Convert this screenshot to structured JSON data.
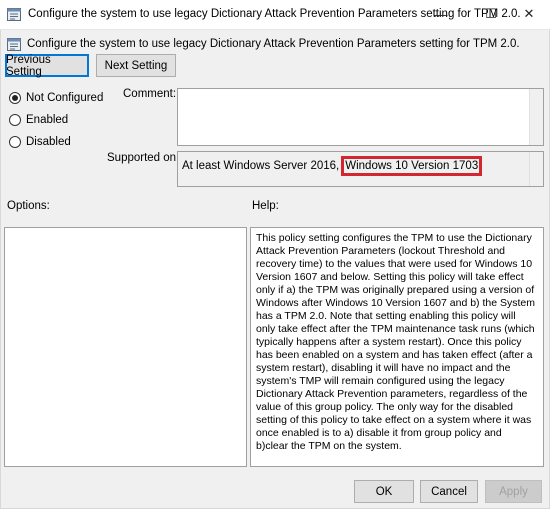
{
  "window": {
    "title": "Configure the system to use legacy Dictionary Attack Prevention Parameters setting for TPM 2.0.",
    "minimize_glyph": "—",
    "maximize_glyph": "☐",
    "close_glyph": "✕"
  },
  "header": {
    "text": "Configure the system to use legacy Dictionary Attack Prevention Parameters setting for TPM 2.0."
  },
  "nav": {
    "previous_label": "Previous Setting",
    "next_label": "Next Setting"
  },
  "state": {
    "options": [
      {
        "label": "Not Configured",
        "checked": true
      },
      {
        "label": "Enabled",
        "checked": false
      },
      {
        "label": "Disabled",
        "checked": false
      }
    ]
  },
  "comment": {
    "label": "Comment:",
    "value": ""
  },
  "supported_on": {
    "label": "Supported on:",
    "prefix": "At least Windows Server 2016,",
    "highlighted": "Windows 10 Version 1703",
    "highlight_color": "#d22730"
  },
  "options_pane": {
    "label": "Options:"
  },
  "help_pane": {
    "label": "Help:",
    "text": "This policy setting configures the TPM to use the Dictionary Attack Prevention Parameters (lockout Threshold and recovery time) to the values that were used for Windows 10 Version 1607 and below. Setting this policy will take effect only if a) the TPM was originally prepared using a version of Windows after Windows 10 Version 1607 and b) the System has a TPM 2.0. Note that setting enabling this policy will only take effect after the TPM maintenance task runs (which typically happens after a system restart). Once this policy has been enabled on a system and has taken effect (after a system restart), disabling it will have no impact and the system's TMP will remain configured using the legacy Dictionary Attack Prevention parameters, regardless of the value of this group policy. The only way for the disabled setting of this policy to take effect on a system where it was once enabled is to a) disable it from group policy and b)clear the TPM on the system."
  },
  "footer": {
    "ok_label": "OK",
    "cancel_label": "Cancel",
    "apply_label": "Apply"
  },
  "colors": {
    "accent": "#0078d7",
    "dialog_bg": "#f0f0f0"
  }
}
